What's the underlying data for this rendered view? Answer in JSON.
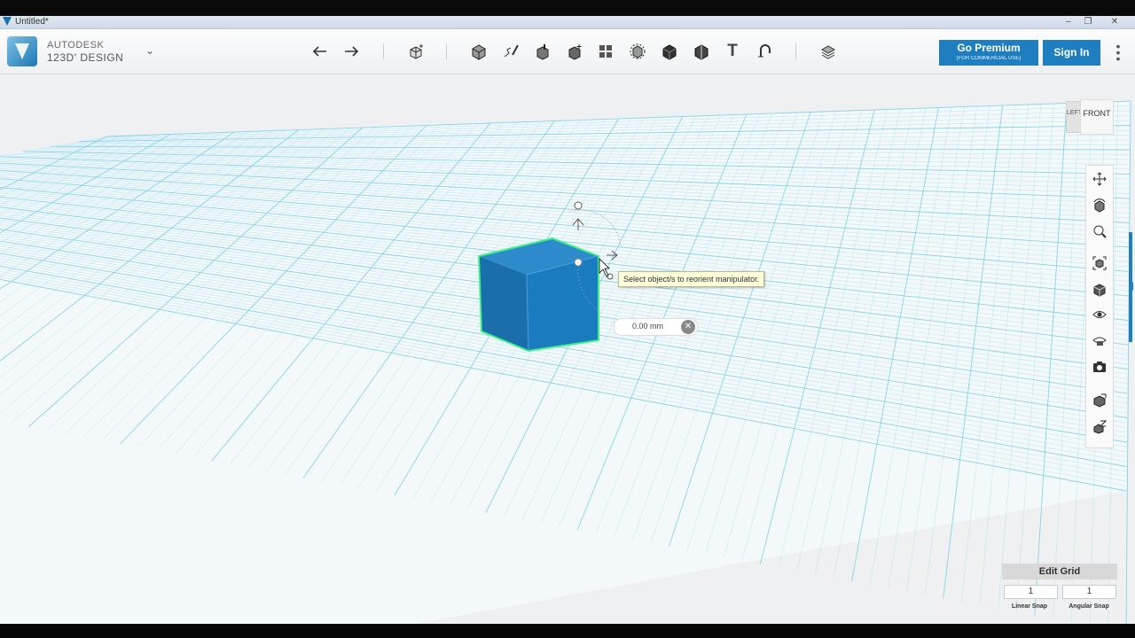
{
  "window": {
    "title": "Untitled*",
    "controls": [
      "–",
      "❐",
      "✕"
    ]
  },
  "toolbar": {
    "brand_line1": "AUTODESK",
    "brand_line2": "123D' DESIGN",
    "premium_label": "Go Premium",
    "premium_sublabel": "(FOR COMMERCIAL USE)",
    "signin_label": "Sign In",
    "tools": [
      "undo-icon",
      "redo-icon",
      "transform-icon",
      "primitives-icon",
      "sketch-icon",
      "construct-icon",
      "modify-icon",
      "pattern-icon",
      "grouping-icon",
      "combine-icon",
      "measure-icon",
      "text-icon",
      "snap-icon",
      "material-icon"
    ]
  },
  "viewport": {
    "tooltip": "Select object/s to reorient manipulator.",
    "dimension_value": "0.00 mm",
    "selected_color": "#1b7bbf",
    "selection_outline": "#3ef28a",
    "grid_color": "#7fd0e6"
  },
  "viewcube": {
    "front_label": "FRONT",
    "left_label": "LEFT"
  },
  "navbar": {
    "items": [
      "pan-icon",
      "orbit-icon",
      "zoom-icon",
      "fit-icon",
      "views-icon",
      "visibility-icon",
      "materials-outlines-icon",
      "snapshot-icon",
      "grid-settings-icon",
      "ungroup-icon"
    ]
  },
  "edit_grid": {
    "title": "Edit Grid",
    "linear_value": "1",
    "angular_value": "1",
    "linear_label": "Linear Snap",
    "angular_label": "Angular Snap"
  }
}
